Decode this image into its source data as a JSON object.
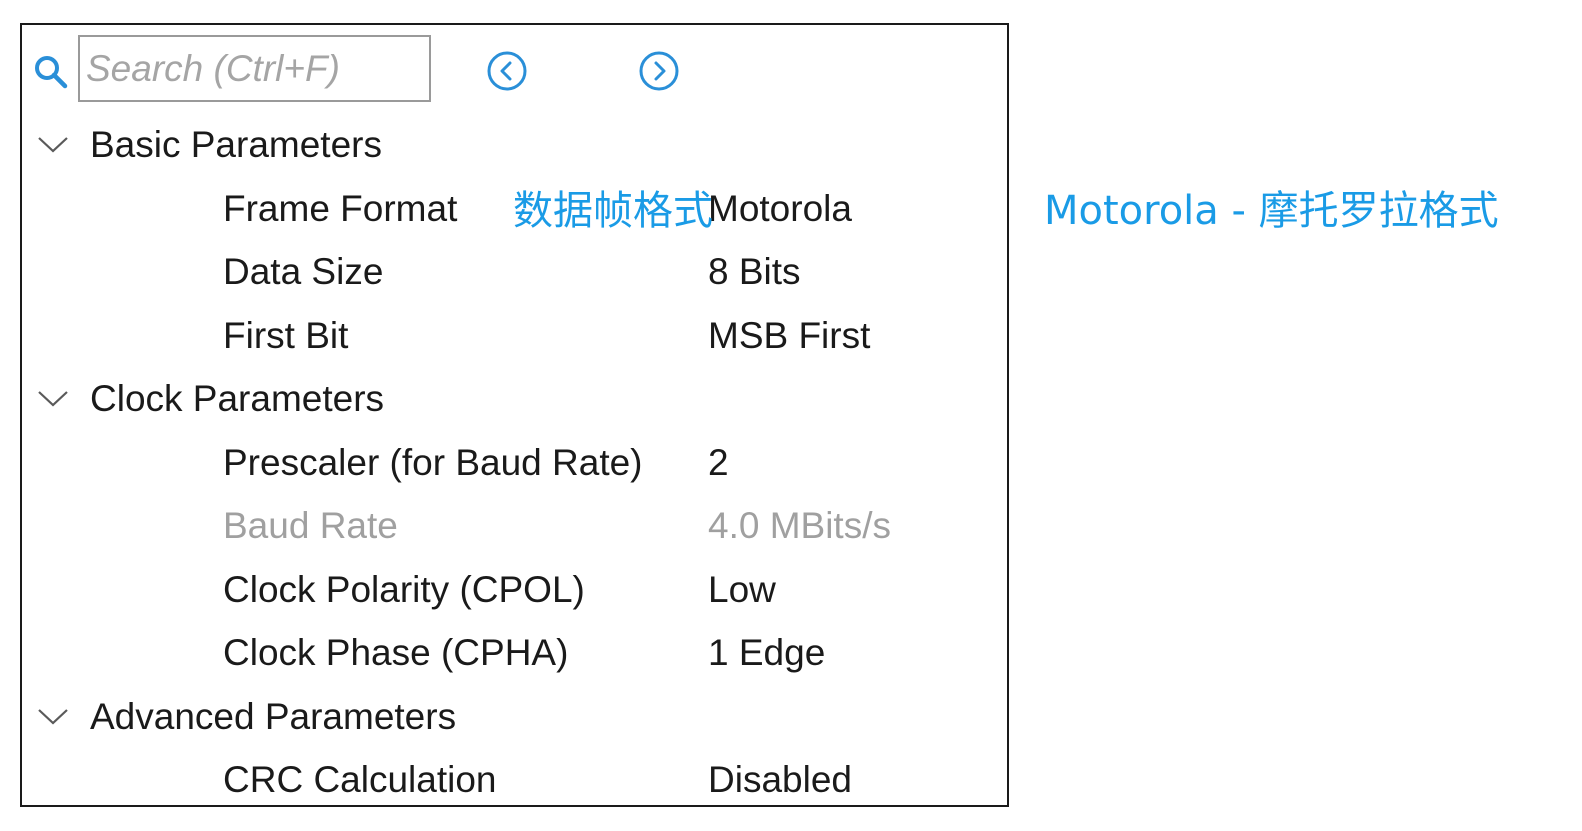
{
  "search": {
    "placeholder": "Search (Ctrl+F)",
    "icon": "search-icon"
  },
  "nav": {
    "prev_icon": "circle-chevron-left-icon",
    "next_icon": "circle-chevron-right-icon"
  },
  "groups": [
    {
      "label": "Basic Parameters",
      "params": [
        {
          "label": "Frame Format",
          "value": "Motorola"
        },
        {
          "label": "Data Size",
          "value": "8 Bits"
        },
        {
          "label": "First Bit",
          "value": "MSB First"
        }
      ]
    },
    {
      "label": "Clock Parameters",
      "params": [
        {
          "label": "Prescaler (for Baud Rate)",
          "value": "2"
        },
        {
          "label": "Baud Rate",
          "value": "4.0 MBits/s"
        },
        {
          "label": "Clock Polarity (CPOL)",
          "value": "Low"
        },
        {
          "label": "Clock Phase (CPHA)",
          "value": "1 Edge"
        }
      ]
    },
    {
      "label": "Advanced Parameters",
      "params": [
        {
          "label": "CRC Calculation",
          "value": "Disabled"
        }
      ]
    }
  ],
  "annotations": {
    "frame_format_note": "数据帧格式",
    "motorola_note": "Motorola - 摩托罗拉格式"
  },
  "colors": {
    "annotation": "#1a9be6",
    "icon_blue": "#2a8fd8",
    "disabled_text": "#a0a0a0"
  }
}
